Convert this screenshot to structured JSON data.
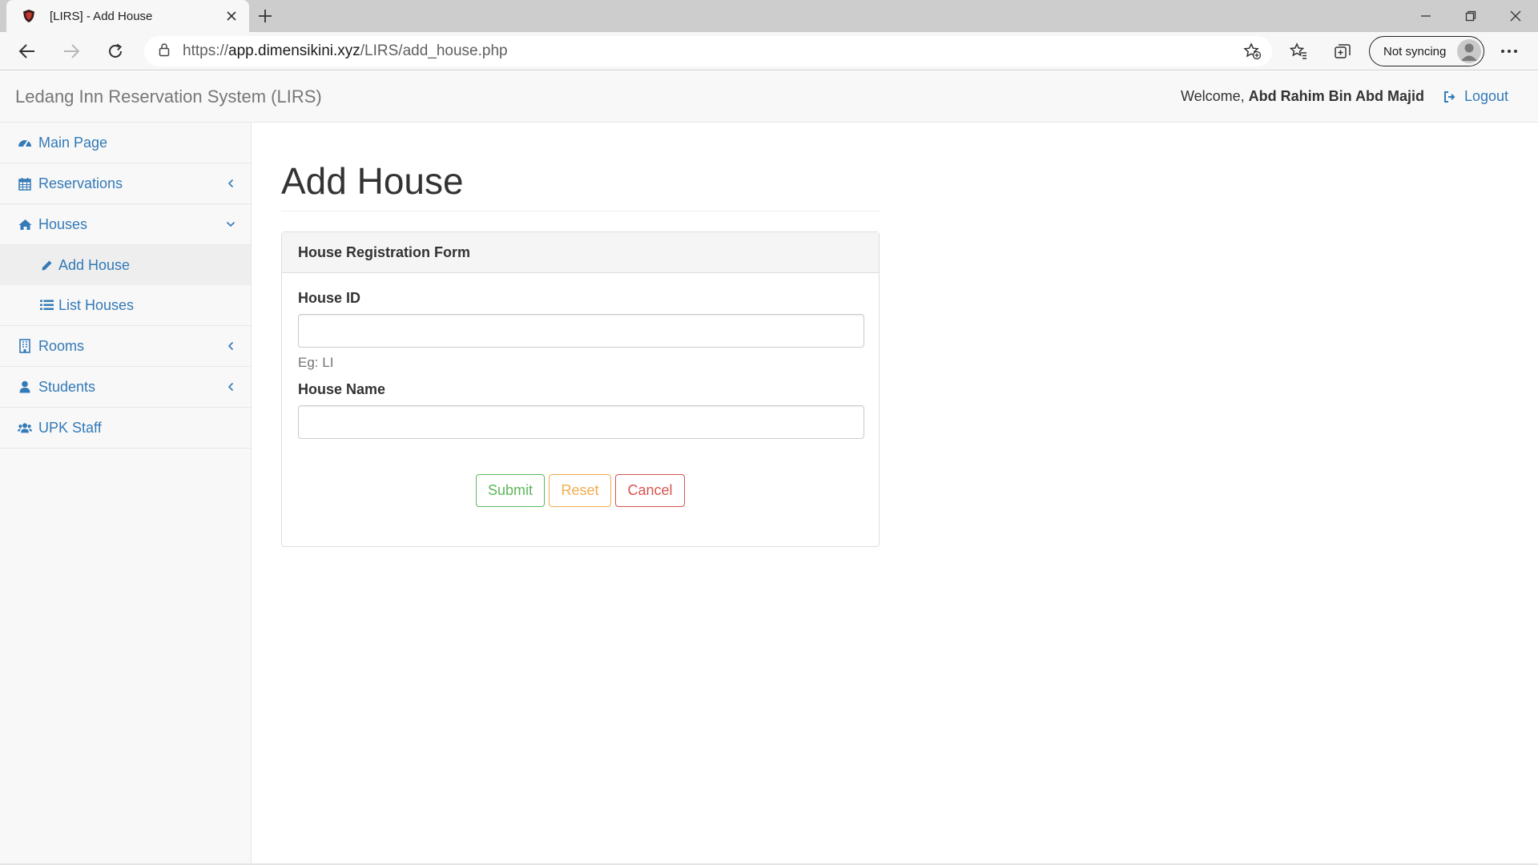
{
  "browser": {
    "tab_title": "[LIRS] - Add House",
    "url_prefix": "https://",
    "url_host": "app.dimensikini.xyz",
    "url_path": "/LIRS/add_house.php",
    "sync_label": "Not syncing"
  },
  "navbar": {
    "brand": "Ledang Inn Reservation System (LIRS)",
    "welcome_prefix": "Welcome, ",
    "user_name": "Abd Rahim Bin Abd Majid",
    "logout_label": "Logout"
  },
  "sidebar": {
    "items": [
      {
        "label": "Main Page",
        "icon": "dashboard-icon"
      },
      {
        "label": "Reservations",
        "icon": "calendar-icon",
        "chevron": "left"
      },
      {
        "label": "Houses",
        "icon": "home-icon",
        "chevron": "down"
      },
      {
        "label": "Rooms",
        "icon": "building-icon",
        "chevron": "left"
      },
      {
        "label": "Students",
        "icon": "user-icon",
        "chevron": "left"
      },
      {
        "label": "UPK Staff",
        "icon": "users-icon"
      }
    ],
    "house_sub": [
      {
        "label": "Add House",
        "icon": "pencil-icon",
        "active": true
      },
      {
        "label": "List Houses",
        "icon": "list-icon"
      }
    ]
  },
  "main": {
    "page_title": "Add House",
    "panel_title": "House Registration Form",
    "fields": {
      "house_id_label": "House ID",
      "house_id_value": "",
      "house_id_help": "Eg: LI",
      "house_name_label": "House Name",
      "house_name_value": ""
    },
    "buttons": {
      "submit": "Submit",
      "reset": "Reset",
      "cancel": "Cancel"
    }
  },
  "colors": {
    "link": "#337ab7",
    "success": "#5cb85c",
    "warning": "#f0ad4e",
    "danger": "#d9534f"
  }
}
